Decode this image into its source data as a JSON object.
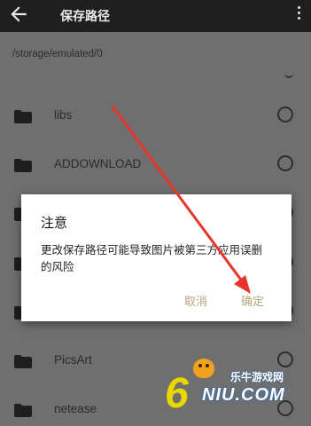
{
  "appbar": {
    "title": "保存路径"
  },
  "path": "/storage/emulated/0",
  "folders": [
    {
      "name": "libs"
    },
    {
      "name": "ADDOWNLOAD"
    },
    {
      "name": ""
    },
    {
      "name": ""
    },
    {
      "name": ""
    },
    {
      "name": "PicsArt"
    },
    {
      "name": "netease"
    }
  ],
  "dialog": {
    "title": "注意",
    "message": "更改保存路径可能导致图片被第三方应用误删的风险",
    "cancel_label": "取消",
    "ok_label": "确定",
    "button_color": "#b8a77c"
  },
  "annotation": {
    "arrow_color": "#e8342c"
  },
  "watermark": {
    "digit": "6",
    "cn": "乐牛游戏网",
    "en": "NIU.COM"
  }
}
